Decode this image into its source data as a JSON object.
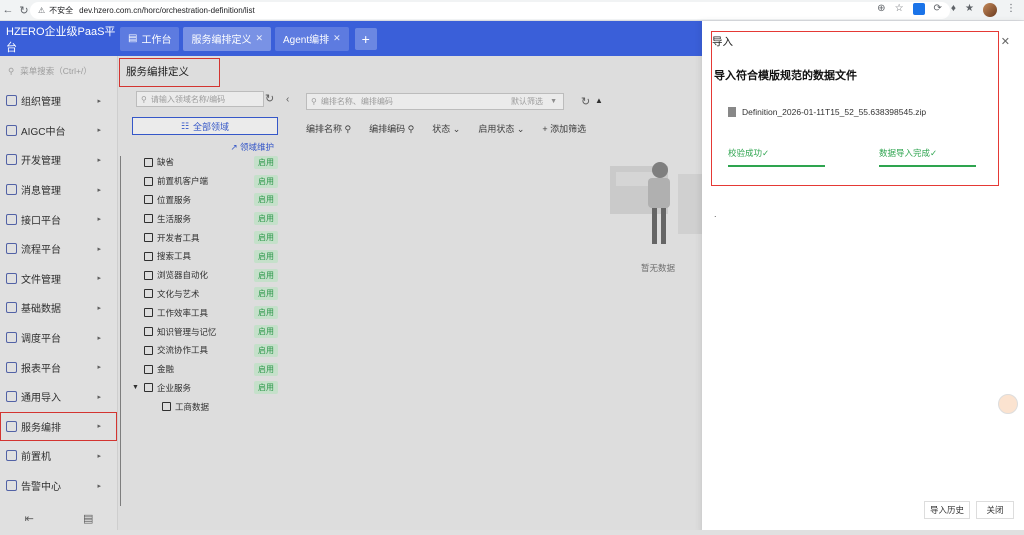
{
  "browser": {
    "insecure": "不安全",
    "url": "dev.hzero.com.cn/horc/orchestration-definition/list"
  },
  "header": {
    "brand": "HZERO企业级PaaS平台",
    "tabs": [
      {
        "label": "工作台"
      },
      {
        "label": "服务编排定义"
      },
      {
        "label": "Agent编排"
      }
    ],
    "add": "+"
  },
  "sidenav": {
    "search_placeholder": "菜单搜索（Ctrl+/）",
    "items": [
      {
        "label": "组织管理"
      },
      {
        "label": "AIGC中台"
      },
      {
        "label": "开发管理"
      },
      {
        "label": "消息管理"
      },
      {
        "label": "接口平台"
      },
      {
        "label": "流程平台"
      },
      {
        "label": "文件管理"
      },
      {
        "label": "基础数据"
      },
      {
        "label": "调度平台"
      },
      {
        "label": "报表平台"
      },
      {
        "label": "通用导入"
      },
      {
        "label": "服务编排"
      },
      {
        "label": "前置机"
      },
      {
        "label": "告警中心"
      }
    ]
  },
  "page": {
    "title": "服务编排定义"
  },
  "tree": {
    "search_placeholder": "请输入领域名称/编码",
    "all_domain": "全部领域",
    "domain_maint": "领域维护",
    "status_label": "启用",
    "items": [
      {
        "label": "缺省"
      },
      {
        "label": "前置机客户端"
      },
      {
        "label": "位置服务"
      },
      {
        "label": "生活服务"
      },
      {
        "label": "开发者工具"
      },
      {
        "label": "搜索工具"
      },
      {
        "label": "浏览器自动化"
      },
      {
        "label": "文化与艺术"
      },
      {
        "label": "工作效率工具"
      },
      {
        "label": "知识管理与记忆"
      },
      {
        "label": "交流协作工具"
      },
      {
        "label": "金融"
      },
      {
        "label": "企业服务"
      }
    ],
    "child": {
      "label": "工商数据"
    }
  },
  "main": {
    "search_placeholder": "编排名称、编排编码",
    "default_filter": "默认筛选",
    "filters": [
      "编排名称",
      "编排编码",
      "状态",
      "启用状态",
      "+ 添加筛选"
    ],
    "empty_text": "暂无数据"
  },
  "drawer": {
    "label": "导入",
    "heading": "导入符合模版规范的数据文件",
    "file_name": "Definition_2026-01-11T15_52_55.638398545.zip",
    "status_validate": "校验成功✓",
    "status_import": "数据导入完成✓",
    "dot": ".",
    "history_button": "导入历史",
    "close_button": "关闭"
  }
}
